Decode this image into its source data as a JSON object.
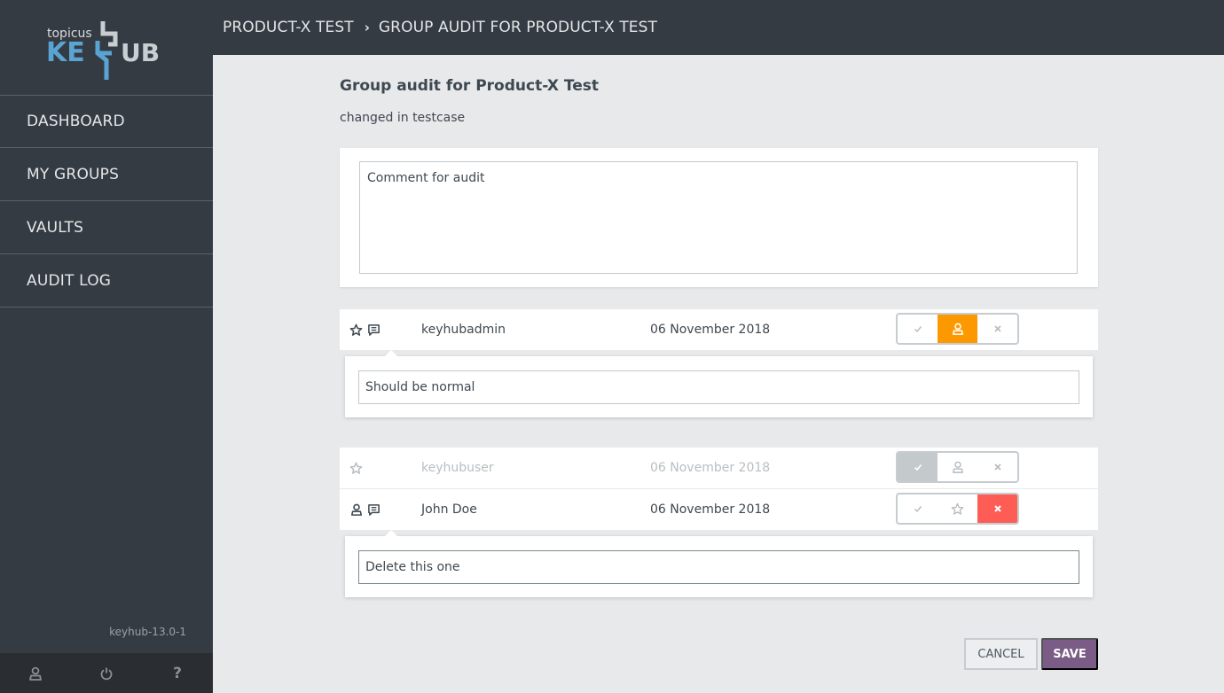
{
  "app": {
    "brand_small": "topicus",
    "brand_left": "KE",
    "brand_right": "UB",
    "version": "keyhub-13.0-1"
  },
  "sidebar": {
    "items": [
      {
        "label": "DASHBOARD"
      },
      {
        "label": "MY GROUPS"
      },
      {
        "label": "VAULTS"
      },
      {
        "label": "AUDIT LOG"
      }
    ],
    "footer": [
      {
        "icon": "user-icon"
      },
      {
        "icon": "power-icon"
      },
      {
        "icon": "help-icon",
        "label": "?"
      }
    ]
  },
  "breadcrumb": {
    "items": [
      "PRODUCT-X TEST",
      "GROUP AUDIT FOR PRODUCT-X TEST"
    ],
    "separator": "›"
  },
  "page": {
    "title": "Group audit for Product-X Test",
    "subtitle": "changed in testcase",
    "comment": "Comment for audit"
  },
  "members": [
    {
      "name": "keyhubadmin",
      "date": "06 November 2018",
      "role_icon": "star-icon",
      "has_comment": true,
      "selected_action": "normal",
      "comment": "Should be normal",
      "muted": false
    },
    {
      "name": "keyhubuser",
      "date": "06 November 2018",
      "role_icon": "star-icon",
      "has_comment": false,
      "selected_action": "keep",
      "muted": true
    },
    {
      "name": "John Doe",
      "date": "06 November 2018",
      "role_icon": "user-icon",
      "has_comment": true,
      "selected_action": "remove",
      "comment": "Delete this one",
      "muted": false
    }
  ],
  "actions": {
    "cancel": "CANCEL",
    "save": "SAVE"
  },
  "colors": {
    "sidebar_bg": "#353b42",
    "accent_orange": "#fd9900",
    "accent_red": "#fe5d55",
    "save_purple": "#7b5c86",
    "logo_blue": "#5aa4d3"
  }
}
